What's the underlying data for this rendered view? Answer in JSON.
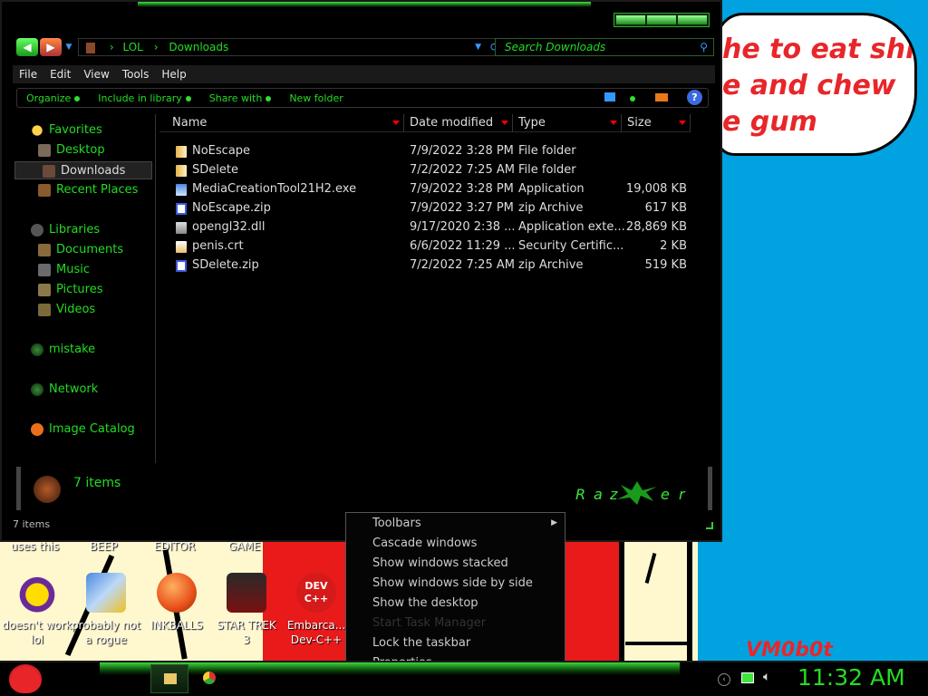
{
  "desktop": {
    "speech_lines": [
      "he to eat shit",
      "e and chew",
      "e gum"
    ],
    "top_labels": [
      "uses this",
      "BEEP",
      "EDITOR",
      "GAME"
    ],
    "icons": [
      {
        "name": "yahoo-messenger-icon",
        "label1": "doesn't work",
        "label2": "lol"
      },
      {
        "name": "gears-icon",
        "label1": "probably not",
        "label2": "a rogue"
      },
      {
        "name": "inkballs-icon",
        "label1": "INKBALLS",
        "label2": ""
      },
      {
        "name": "star-trek-icon",
        "label1": "STAR TREK",
        "label2": "3"
      },
      {
        "name": "dev-cpp-icon",
        "label1": "Embarca...",
        "label2": "Dev-C++"
      }
    ],
    "devcpp_badge": "DEV C++",
    "watermark": "VM0b0t"
  },
  "explorer": {
    "address": [
      "LOL",
      "Downloads"
    ],
    "search_placeholder": "Search Downloads",
    "menu": [
      "File",
      "Edit",
      "View",
      "Tools",
      "Help"
    ],
    "commands": [
      "Organize",
      "Include in library",
      "Share with",
      "New folder"
    ],
    "nav": {
      "favorites": "Favorites",
      "desktop": "Desktop",
      "downloads": "Downloads",
      "recent": "Recent Places",
      "libraries": "Libraries",
      "documents": "Documents",
      "music": "Music",
      "pictures": "Pictures",
      "videos": "Videos",
      "homegroup": "mistake",
      "network": "Network",
      "catalog": "Image Catalog"
    },
    "columns": [
      "Name",
      "Date modified",
      "Type",
      "Size"
    ],
    "files": [
      {
        "name": "NoEscape",
        "date": "7/9/2022 3:28 PM",
        "type": "File folder",
        "size": "",
        "icon": "folder-icon"
      },
      {
        "name": "SDelete",
        "date": "7/2/2022 7:25 AM",
        "type": "File folder",
        "size": "",
        "icon": "folder-icon"
      },
      {
        "name": "MediaCreationTool21H2.exe",
        "date": "7/9/2022 3:28 PM",
        "type": "Application",
        "size": "19,008 KB",
        "icon": "setup-exe-icon"
      },
      {
        "name": "NoEscape.zip",
        "date": "7/9/2022 3:27 PM",
        "type": "zip Archive",
        "size": "617 KB",
        "icon": "zip-icon"
      },
      {
        "name": "opengl32.dll",
        "date": "9/17/2020 2:38 ...",
        "type": "Application exte...",
        "size": "28,869 KB",
        "icon": "dll-icon"
      },
      {
        "name": "penis.crt",
        "date": "6/6/2022 11:29 ...",
        "type": "Security Certific...",
        "size": "2 KB",
        "icon": "certificate-icon"
      },
      {
        "name": "SDelete.zip",
        "date": "7/2/2022 7:25 AM",
        "type": "zip Archive",
        "size": "519 KB",
        "icon": "zip-icon"
      }
    ],
    "detail_count": "7 items",
    "status": "7 items"
  },
  "context_menu": {
    "items": [
      "Toolbars",
      "Cascade windows",
      "Show windows stacked",
      "Show windows side by side",
      "Show the desktop",
      "Start Task Manager",
      "Lock the taskbar",
      "Properties"
    ]
  },
  "taskbar": {
    "clock": "11:32 AM"
  }
}
